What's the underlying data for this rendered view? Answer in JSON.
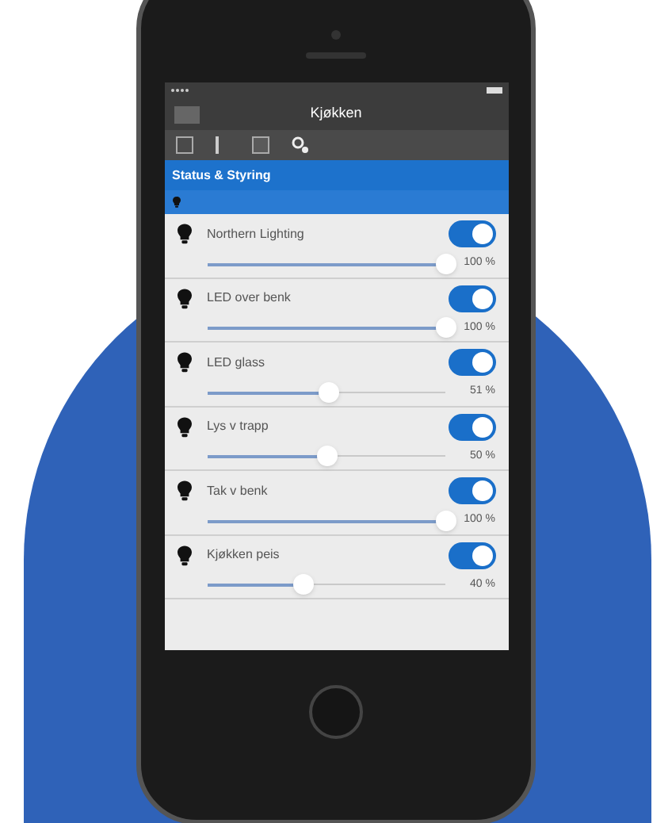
{
  "app_bar": {
    "title": "Kjøkken"
  },
  "section": {
    "title": "Status & Styring"
  },
  "lights": [
    {
      "name": "Northern Lighting",
      "on": true,
      "level": 1.0,
      "reading": "100 %"
    },
    {
      "name": "LED over benk",
      "on": true,
      "level": 1.0,
      "reading": "100 %"
    },
    {
      "name": "LED glass",
      "on": true,
      "level": 0.51,
      "reading": "51 %"
    },
    {
      "name": "Lys v trapp",
      "on": true,
      "level": 0.5,
      "reading": "50 %"
    },
    {
      "name": "Tak v benk",
      "on": true,
      "level": 1.0,
      "reading": "100 %"
    },
    {
      "name": "Kjøkken peis",
      "on": true,
      "level": 0.4,
      "reading": "40 %"
    }
  ]
}
